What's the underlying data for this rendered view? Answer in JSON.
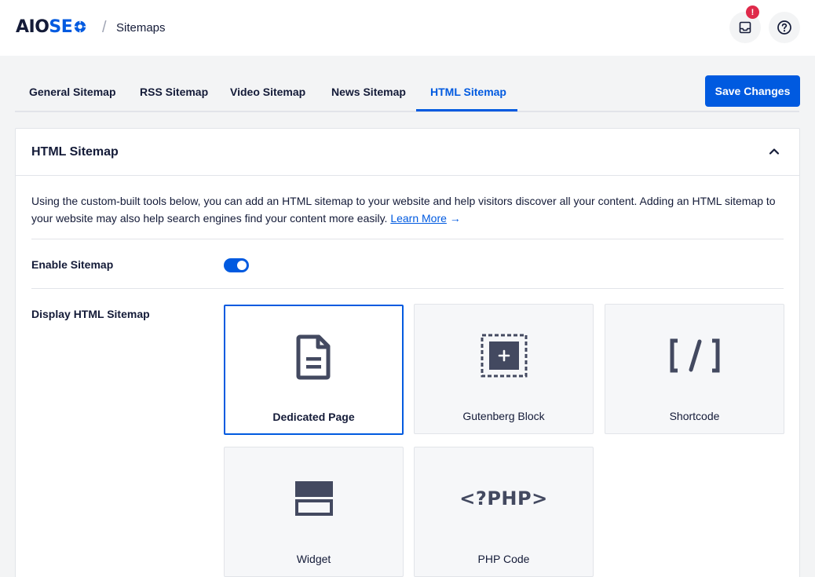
{
  "header": {
    "logo_text_a": "AIO",
    "logo_text_b": "SE",
    "breadcrumb_sep": "/",
    "breadcrumb": "Sitemaps",
    "notification_badge": "!",
    "brand_color": "#005ae0"
  },
  "tabs": [
    {
      "label": "General Sitemap"
    },
    {
      "label": "RSS Sitemap"
    },
    {
      "label": "Video Sitemap"
    },
    {
      "label": "News Sitemap"
    },
    {
      "label": "HTML Sitemap",
      "active": true
    }
  ],
  "save_label": "Save Changes",
  "card": {
    "title": "HTML Sitemap",
    "description": "Using the custom-built tools below, you can add an HTML sitemap to your website and help visitors discover all your content. Adding an HTML sitemap to your website may also help search engines find your content more easily.",
    "learn_more": "Learn More",
    "learn_more_arrow": "→",
    "enable_label": "Enable Sitemap",
    "enable_value": true,
    "display_label": "Display HTML Sitemap",
    "options": [
      {
        "label": "Dedicated Page",
        "icon": "document-icon",
        "selected": true
      },
      {
        "label": "Gutenberg Block",
        "icon": "block-plus-icon"
      },
      {
        "label": "Shortcode",
        "icon": "shortcode-icon",
        "glyph": "[/]"
      },
      {
        "label": "Widget",
        "icon": "widget-icon"
      },
      {
        "label": "PHP Code",
        "icon": "php-icon",
        "glyph": "<?PHP>"
      }
    ]
  }
}
